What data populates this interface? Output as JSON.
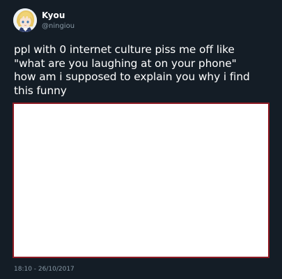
{
  "user": {
    "display_name": "Kyou",
    "handle": "@ningiou"
  },
  "tweet": {
    "text": "ppl with 0 internet culture piss me off like\n\"what are you laughing at on your phone\"\nhow am i supposed to explain you why i find\nthis funny",
    "timestamp": "18:10 - 26/10/2017"
  },
  "colors": {
    "background": "#141d26",
    "text": "#ffffff",
    "secondary_text": "#8899a6",
    "media_border": "#8e1b24",
    "media_fill": "#ffffff"
  },
  "icons": {
    "avatar": "anime-character-avatar"
  }
}
